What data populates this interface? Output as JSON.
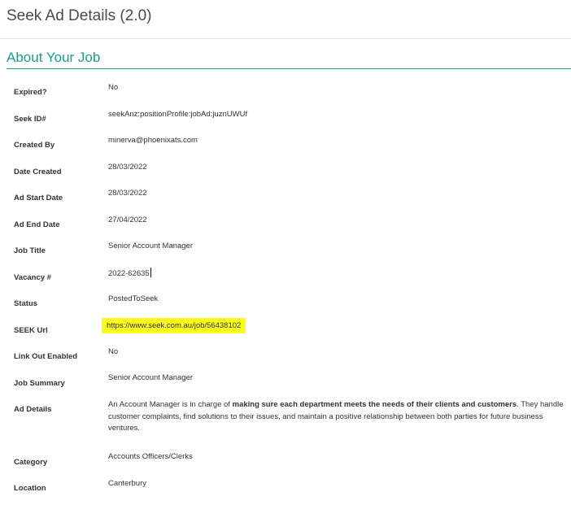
{
  "page": {
    "title": "Seek Ad Details (2.0)"
  },
  "section": {
    "title": "About Your Job"
  },
  "fields": {
    "expired": {
      "label": "Expired?",
      "value": "No"
    },
    "seek_id": {
      "label": "Seek ID#",
      "value": "seekAnz:positionProfile:jobAd:juznUWUf"
    },
    "created_by": {
      "label": "Created By",
      "value": "minerva@phoenixats.com"
    },
    "date_created": {
      "label": "Date Created",
      "value": "28/03/2022"
    },
    "ad_start": {
      "label": "Ad Start Date",
      "value": "28/03/2022"
    },
    "ad_end": {
      "label": "Ad End Date",
      "value": "27/04/2022"
    },
    "job_title": {
      "label": "Job Title",
      "value": "Senior Account Manager"
    },
    "vacancy": {
      "label": "Vacancy #",
      "value": "2022-62635"
    },
    "status": {
      "label": "Status",
      "value": "PostedToSeek"
    },
    "seek_url": {
      "label": "SEEK Url",
      "value": "https://www.seek.com.au/job/56438102",
      "highlight_color": "#fbfb1e"
    },
    "link_out": {
      "label": "Link Out Enabled",
      "value": "No"
    },
    "job_summary": {
      "label": "Job Summary",
      "value": "Senior Account Manager"
    },
    "ad_details": {
      "label": "Ad Details",
      "text_before": "An Account Manager is in charge of ",
      "text_bold": "making sure each department meets the needs of their clients and customers",
      "text_after": ". They handle customer complaints, find solutions to their issues, and maintain a positive relationship between both parties for future business ventures."
    },
    "category": {
      "label": "Category",
      "value": "Accounts Officers/Clerks"
    },
    "location": {
      "label": "Location",
      "value": "Canterbury"
    }
  },
  "colors": {
    "accent": "#1a9b8e",
    "highlight": "#fbfb1e"
  }
}
